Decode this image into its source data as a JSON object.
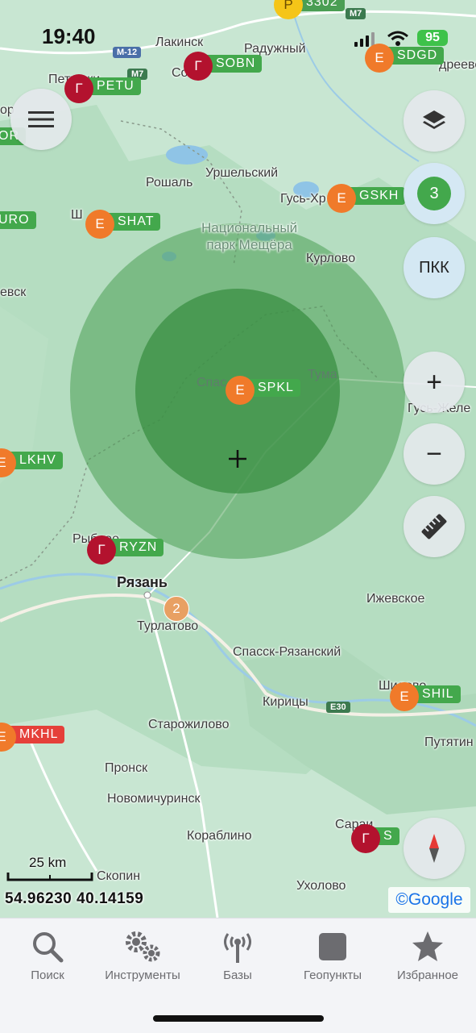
{
  "status_bar": {
    "time": "19:40",
    "battery": "95"
  },
  "places": {
    "lakinsk": "Лакинск",
    "raduzhny": "Радужный",
    "petushki": "Петушки",
    "sobinka": "Соб",
    "orekh": "ор",
    "sdgd_town": "дреево",
    "roshal": "Рошаль",
    "urshelsky": "Уршельский",
    "gus": "Гусь-Хр",
    "park": "Национальный\nпарк Мещёра",
    "kurlovo": "Курлово",
    "shatura": "Ш",
    "evsk": "евск",
    "spas": "Спас",
    "tuma": "Тума",
    "gus_zhel": "Гусь-Желе",
    "rybnoe": "Рыбное",
    "ryazan": "Рязань",
    "turlatovo": "Турлатово",
    "izhevskoe": "Ижевское",
    "spassk": "Спасск-Рязанский",
    "kiritsy": "Кирицы",
    "shilovo": "Шилово",
    "putyatino": "Путятин",
    "starozhilovo": "Старожилово",
    "pronsk": "Пронск",
    "novomichurinsk": "Новомичуринск",
    "korablino": "Кораблино",
    "sarayi": "Сараи",
    "skopin": "Скопин",
    "ukholovo": "Ухолово"
  },
  "roads": {
    "m12": "М-12",
    "m7_top": "М7",
    "m7": "М7",
    "e30": "E30",
    "road_3302": "3302"
  },
  "stations": [
    {
      "id": "petu",
      "letter": "Г",
      "code": "PETU"
    },
    {
      "id": "sobn",
      "letter": "Г",
      "code": "SOBN"
    },
    {
      "id": "sdgd",
      "letter": "Е",
      "code": "SDGD"
    },
    {
      "id": "or",
      "letter": "",
      "code": "OR"
    },
    {
      "id": "gskh",
      "letter": "Е",
      "code": "GSKH"
    },
    {
      "id": "uro",
      "letter": "",
      "code": "URO"
    },
    {
      "id": "shat",
      "letter": "Е",
      "code": "SHAT"
    },
    {
      "id": "spkl",
      "letter": "Е",
      "code": "SPKL"
    },
    {
      "id": "lkhv",
      "letter": "Е",
      "code": "LKHV"
    },
    {
      "id": "ryzn",
      "letter": "Г",
      "code": "RYZN"
    },
    {
      "id": "shil",
      "letter": "Е",
      "code": "SHIL"
    },
    {
      "id": "mkhl",
      "letter": "Е",
      "code": "MKHL"
    },
    {
      "id": "sar",
      "letter": "Г",
      "code": "S"
    },
    {
      "id": "top",
      "letter": "Р",
      "code": "3302"
    }
  ],
  "cluster_count": "2",
  "controls": {
    "layers_count": "3",
    "pkk": "ПКК",
    "zoom_in": "+",
    "zoom_out": "−"
  },
  "scale": "25 km",
  "coordinates": "54.96230 40.14159",
  "attribution": "©Google",
  "nav": [
    {
      "label": "Поиск",
      "icon": "search-icon"
    },
    {
      "label": "Инструменты",
      "icon": "gears-icon"
    },
    {
      "label": "Базы",
      "icon": "antenna-icon"
    },
    {
      "label": "Геопункты",
      "icon": "square-icon"
    },
    {
      "label": "Избранное",
      "icon": "star-icon"
    }
  ],
  "colors": {
    "circle_outer": "#4a9e53",
    "circle_inner": "#3a8f43",
    "station_green": "#43a84c",
    "station_red": "#e5403a",
    "marker_orange": "#f07a2a",
    "marker_darkred": "#b3122e"
  }
}
